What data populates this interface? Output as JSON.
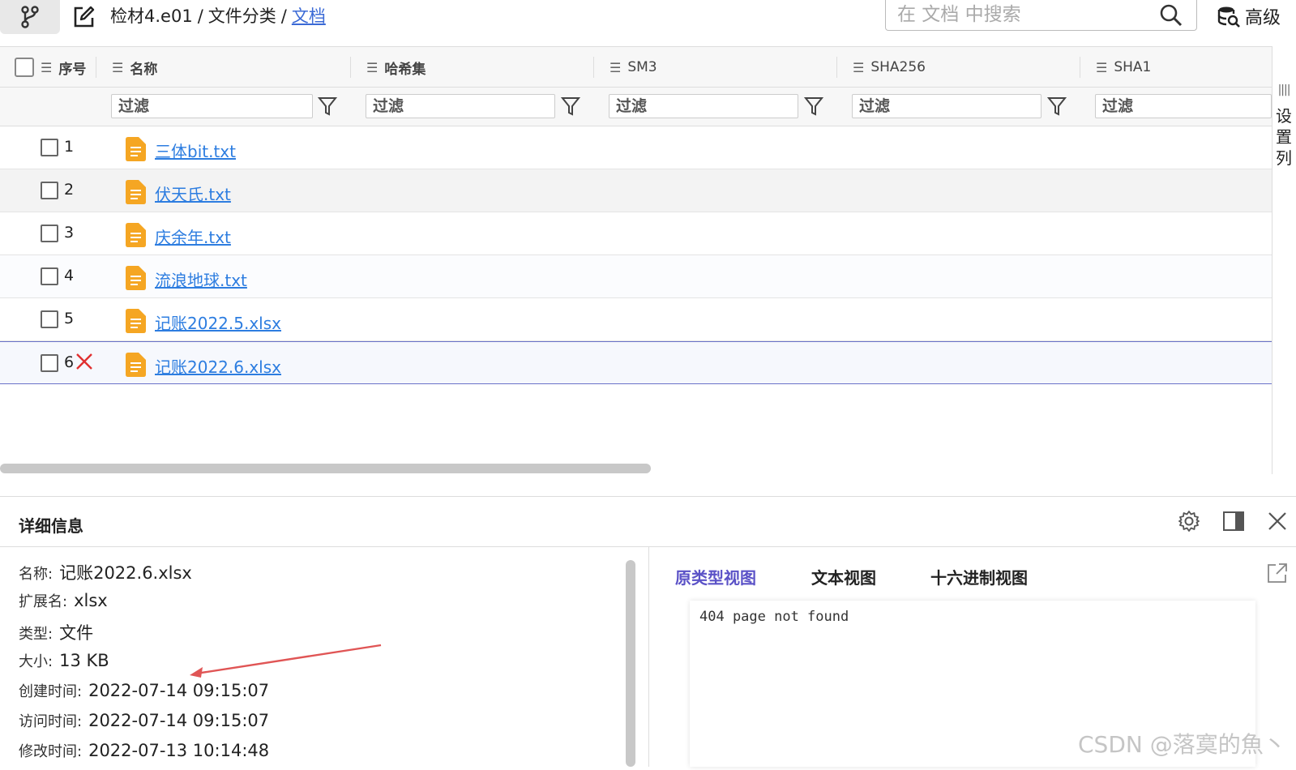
{
  "topbar": {
    "breadcrumb": [
      "检材4.e01",
      "文件分类",
      "文档"
    ],
    "search_placeholder": "在 文档 中搜索",
    "advanced_label": "高级"
  },
  "table": {
    "columns": [
      "序号",
      "名称",
      "哈希集",
      "SM3",
      "SHA256",
      "SHA1"
    ],
    "filter_placeholder": "过滤",
    "settings_label": [
      "设",
      "置",
      "列"
    ],
    "rows": [
      {
        "index": "1",
        "name": "三体bit.txt"
      },
      {
        "index": "2",
        "name": "伏天氏.txt"
      },
      {
        "index": "3",
        "name": "庆余年.txt"
      },
      {
        "index": "4",
        "name": "流浪地球.txt"
      },
      {
        "index": "5",
        "name": "记账2022.5.xlsx"
      },
      {
        "index": "6",
        "name": "记账2022.6.xlsx"
      }
    ]
  },
  "details": {
    "title": "详细信息",
    "properties": [
      {
        "key": "名称:",
        "value": "记账2022.6.xlsx"
      },
      {
        "key": "扩展名:",
        "value": "xlsx"
      },
      {
        "key": "类型:",
        "value": "文件"
      },
      {
        "key": "大小:",
        "value": "13 KB"
      },
      {
        "key": "创建时间:",
        "value": "2022-07-14 09:15:07"
      },
      {
        "key": "访问时间:",
        "value": "2022-07-14 09:15:07"
      },
      {
        "key": "修改时间:",
        "value": "2022-07-13 10:14:48"
      }
    ],
    "view_tabs": [
      "原类型视图",
      "文本视图",
      "十六进制视图"
    ],
    "active_tab": "原类型视图",
    "viewer_text": "404 page not found"
  },
  "watermark": "CSDN @落寞的魚丶",
  "colors": {
    "link": "#2d7de0",
    "active_tab": "#5b52c7",
    "file_icon": "#f5a623",
    "delete_mark": "#e03030",
    "selected_border": "#6a72c9",
    "arrow": "#e05555"
  },
  "icons": [
    "branch-icon",
    "edit-icon",
    "search-icon",
    "advanced-search-icon",
    "list-icon",
    "filter-icon",
    "file-icon",
    "delete-mark-icon",
    "gear-icon",
    "split-view-icon",
    "close-icon",
    "external-link-icon"
  ]
}
